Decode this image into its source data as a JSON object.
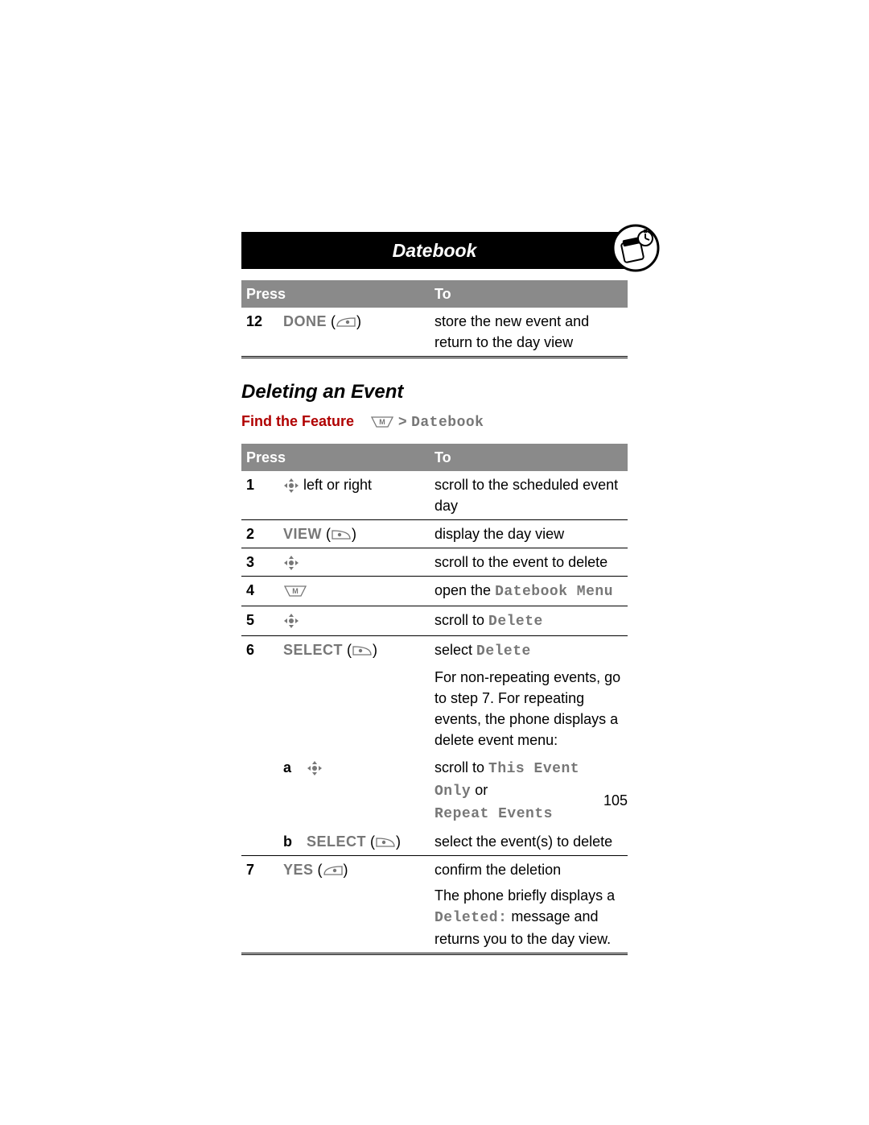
{
  "header": {
    "title": "Datebook"
  },
  "icon": {
    "corner_name": "datebook-icon"
  },
  "tables": {
    "t1": {
      "head_press": "Press",
      "head_to": "To",
      "rows": [
        {
          "num": "12",
          "press_key": "DONE",
          "press_glyph": "left-softkey",
          "to": "store the new event and return to the day view"
        }
      ]
    },
    "t2": {
      "head_press": "Press",
      "head_to": "To",
      "r1": {
        "num": "1",
        "press_glyph": "nav-4way",
        "press_suffix": " left or right",
        "to": "scroll to the scheduled event day"
      },
      "r2": {
        "num": "2",
        "press_key": "VIEW",
        "press_glyph": "right-softkey",
        "to": "display the day view"
      },
      "r3": {
        "num": "3",
        "press_glyph": "nav-4way",
        "to": "scroll to the event to delete"
      },
      "r4": {
        "num": "4",
        "press_glyph": "menu-key",
        "to_pre": "open the ",
        "to_menutext": "Datebook Menu"
      },
      "r5": {
        "num": "5",
        "press_glyph": "nav-4way",
        "to_pre": "scroll to ",
        "to_menutext": "Delete"
      },
      "r6": {
        "num": "6",
        "press_key": "SELECT",
        "press_glyph": "right-softkey",
        "to_pre": "select ",
        "to_menutext": "Delete",
        "to_para": "For non-repeating events, go to step 7. For repeating events, the phone displays a delete event menu:"
      },
      "r6a": {
        "letter": "a",
        "press_glyph": "nav-4way",
        "to_pre": "scroll to ",
        "to_mt1": "This Event Only",
        "to_mid": " or ",
        "to_mt2": "Repeat Events"
      },
      "r6b": {
        "letter": "b",
        "press_key": "SELECT",
        "press_glyph": "right-softkey",
        "to": "select the event(s) to delete"
      },
      "r7": {
        "num": "7",
        "press_key": "YES",
        "press_glyph": "left-softkey",
        "to_line1": "confirm the deletion",
        "to_para_pre": "The phone briefly displays a ",
        "to_para_mt": "Deleted:",
        "to_para_post": " message and returns you to the day view."
      }
    }
  },
  "section_heading": "Deleting an Event",
  "find": {
    "label": "Find the Feature",
    "glyph": "menu-key",
    "arrow": ">",
    "target": "Datebook"
  },
  "page_number": "105"
}
